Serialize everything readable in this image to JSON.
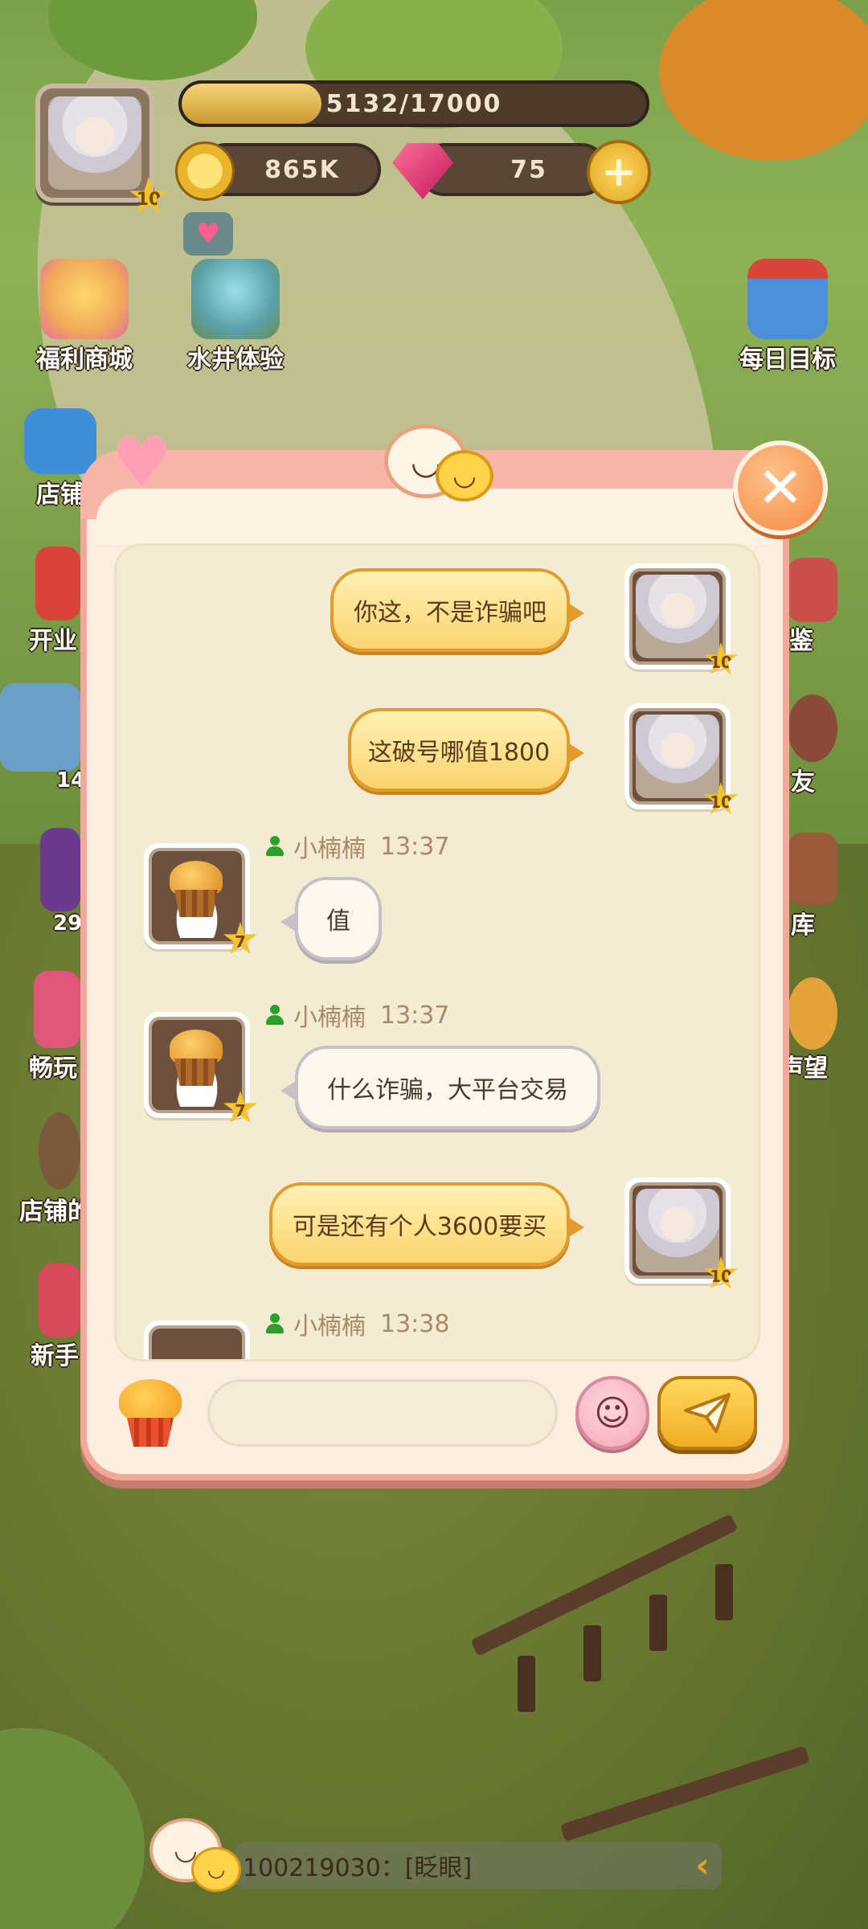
{
  "hud": {
    "player_level": "10",
    "xp_text": "5132/17000",
    "xp_progress": 0.3019,
    "coins": "865K",
    "gems": "75",
    "plus_icon": "plus-icon"
  },
  "side_menu_left": [
    {
      "label": "福利商城",
      "icon": "vip-gift-icon"
    },
    {
      "label": "水井体验",
      "icon": "well-icon"
    },
    {
      "label": "店铺",
      "icon": "video-icon"
    },
    {
      "label": "开业",
      "icon": "gift-icon"
    },
    {
      "label": "14",
      "icon": "shop-icon"
    },
    {
      "label": "29",
      "icon": "book-icon"
    },
    {
      "label": "畅玩",
      "icon": "play-icon"
    },
    {
      "label": "店铺的",
      "icon": "character-icon"
    },
    {
      "label": "新手",
      "icon": "newbie-icon"
    }
  ],
  "side_menu_right": [
    {
      "label": "每日目标",
      "icon": "calendar-icon"
    },
    {
      "label": "鉴",
      "icon": "collection-icon"
    },
    {
      "label": "友",
      "icon": "friends-icon"
    },
    {
      "label": "库",
      "icon": "warehouse-icon"
    },
    {
      "label": "声望",
      "icon": "reputation-icon"
    }
  ],
  "chat": {
    "messages": [
      {
        "side": "right",
        "text": "你这，不是诈骗吧",
        "level": "10"
      },
      {
        "side": "right",
        "text": "这破号哪值1800",
        "level": "10"
      },
      {
        "side": "left",
        "sender": "小楠楠",
        "time": "13:37",
        "text": "值",
        "level": "7"
      },
      {
        "side": "left",
        "sender": "小楠楠",
        "time": "13:37",
        "text": "什么诈骗，大平台交易",
        "level": "7"
      },
      {
        "side": "right",
        "text": "可是还有个人3600要买",
        "level": "10"
      },
      {
        "side": "left",
        "sender": "小楠楠",
        "time": "13:38",
        "text": "",
        "level": "7"
      }
    ],
    "input_value": "",
    "input_placeholder": ""
  },
  "ticker": {
    "text": "100219030：[眨眼]"
  },
  "colors": {
    "modal_border": "#f3a99a",
    "bubble_self": "#fbd46e",
    "bubble_other": "#fdf7ee",
    "close_button": "#f38a45"
  }
}
